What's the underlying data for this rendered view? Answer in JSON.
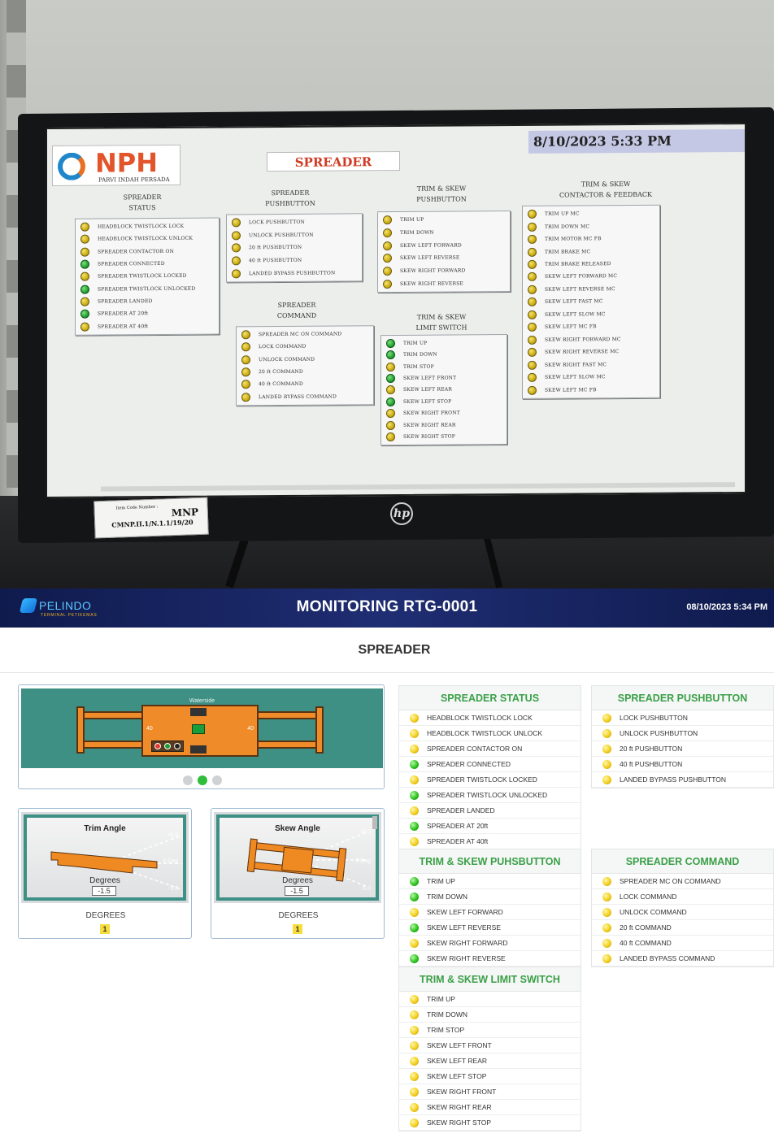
{
  "photo": {
    "hmi": {
      "logo_text": "NPH",
      "logo_sub": "PARVI INDAH PERSADA",
      "screen_title": "SPREADER",
      "datetime": "8/10/2023 5:33 PM",
      "titles": {
        "status": "SPREADER\nSTATUS",
        "pushbutton": "SPREADER\nPUSHBUTTON",
        "command": "SPREADER\nCOMMAND",
        "trim_push": "TRIM & SKEW\nPUSHBUTTON",
        "trim_limit": "TRIM & SKEW\nLIMIT SWITCH",
        "contactor": "TRIM & SKEW\nCONTACTOR & FEEDBACK"
      },
      "status_items": [
        {
          "label": "HEADBLOCK TWISTLOCK LOCK",
          "state": "yellow"
        },
        {
          "label": "HEADBLOCK TWISTLOCK UNLOCK",
          "state": "yellow"
        },
        {
          "label": "SPREADER CONTACTOR ON",
          "state": "yellow"
        },
        {
          "label": "SPREADER CONNECTED",
          "state": "green"
        },
        {
          "label": "SPREADER TWISTLOCK LOCKED",
          "state": "yellow"
        },
        {
          "label": "SPREADER TWISTLOCK UNLOCKED",
          "state": "green"
        },
        {
          "label": "SPREADER LANDED",
          "state": "yellow"
        },
        {
          "label": "SPREADER AT 20ft",
          "state": "green"
        },
        {
          "label": "SPREADER AT 40ft",
          "state": "yellow"
        }
      ],
      "pushbutton_items": [
        {
          "label": "LOCK PUSHBUTTON",
          "state": "yellow"
        },
        {
          "label": "UNLOCK PUSHBUTTON",
          "state": "yellow"
        },
        {
          "label": "20 ft PUSHBUTTON",
          "state": "yellow"
        },
        {
          "label": "40 ft PUSHBUTTON",
          "state": "yellow"
        },
        {
          "label": "LANDED BYPASS PUSHBUTTON",
          "state": "yellow"
        }
      ],
      "command_items": [
        {
          "label": "SPREADER MC ON COMMAND",
          "state": "yellow"
        },
        {
          "label": "LOCK COMMAND",
          "state": "yellow"
        },
        {
          "label": "UNLOCK COMMAND",
          "state": "yellow"
        },
        {
          "label": "20 ft COMMAND",
          "state": "yellow"
        },
        {
          "label": "40 ft COMMAND",
          "state": "yellow"
        },
        {
          "label": "LANDED BYPASS COMMAND",
          "state": "yellow"
        }
      ],
      "trim_push_items": [
        {
          "label": "TRIM UP",
          "state": "yellow"
        },
        {
          "label": "TRIM DOWN",
          "state": "yellow"
        },
        {
          "label": "SKEW LEFT FORWARD",
          "state": "yellow"
        },
        {
          "label": "SKEW LEFT REVERSE",
          "state": "yellow"
        },
        {
          "label": "SKEW RIGHT FORWARD",
          "state": "yellow"
        },
        {
          "label": "SKEW RIGHT REVERSE",
          "state": "yellow"
        }
      ],
      "trim_limit_items": [
        {
          "label": "TRIM UP",
          "state": "green"
        },
        {
          "label": "TRIM DOWN",
          "state": "green"
        },
        {
          "label": "TRIM STOP",
          "state": "yellow"
        },
        {
          "label": "SKEW LEFT FRONT",
          "state": "green"
        },
        {
          "label": "SKEW LEFT REAR",
          "state": "yellow"
        },
        {
          "label": "SKEW LEFT STOP",
          "state": "green"
        },
        {
          "label": "SKEW RIGHT FRONT",
          "state": "yellow"
        },
        {
          "label": "SKEW RIGHT REAR",
          "state": "yellow"
        },
        {
          "label": "SKEW RIGHT STOP",
          "state": "yellow"
        }
      ],
      "contactor_items": [
        {
          "label": "TRIM UP MC",
          "state": "yellow"
        },
        {
          "label": "TRIM DOWN MC",
          "state": "yellow"
        },
        {
          "label": "TRIM MOTOR MC FB",
          "state": "yellow"
        },
        {
          "label": "TRIM BRAKE MC",
          "state": "yellow"
        },
        {
          "label": "TRIM BRAKE RELEASED",
          "state": "yellow"
        },
        {
          "label": "SKEW LEFT FORWARD MC",
          "state": "yellow"
        },
        {
          "label": "SKEW LEFT REVERSE MC",
          "state": "yellow"
        },
        {
          "label": "SKEW LEFT FAST MC",
          "state": "yellow"
        },
        {
          "label": "SKEW LEFT SLOW MC",
          "state": "yellow"
        },
        {
          "label": "SKEW LEFT MC FB",
          "state": "yellow"
        },
        {
          "label": "SKEW RIGHT FORWARD MC",
          "state": "yellow"
        },
        {
          "label": "SKEW RIGHT REVERSE MC",
          "state": "yellow"
        },
        {
          "label": "SKEW RIGHT FAST MC",
          "state": "yellow"
        },
        {
          "label": "SKEW LEFT SLOW MC",
          "state": "yellow"
        },
        {
          "label": "SKEW LEFT MC FB",
          "state": "yellow"
        }
      ],
      "asset_label_title": "Item Code Number :",
      "asset_label_code": "CMNP.II.1/N.1.1/19/20",
      "asset_label_brand": "MNP",
      "monitor_brand": "hp"
    }
  },
  "header": {
    "brand_name": "PELINDO",
    "brand_sub": "TERMINAL PETIKEMAS",
    "title": "MONITORING RTG-0001",
    "datetime": "08/10/2023 5:34 PM"
  },
  "page": {
    "title": "SPREADER"
  },
  "carousel": {
    "waterside_label": "Waterside",
    "left_size": "40",
    "right_size": "40",
    "active_slide": 2,
    "slides": 3
  },
  "trim_angle": {
    "title": "Trim Angle",
    "degrees_label": "Degrees",
    "value": "-1.5",
    "tick_top": "+5.0",
    "tick_mid": "0 Deg",
    "tick_bottom": "-5.0",
    "caption": "DEGREES",
    "reading": "1"
  },
  "skew_angle": {
    "title": "Skew Angle",
    "degrees_label": "Degrees",
    "value": "-1.5",
    "tick_top": "+5.0",
    "tick_mid": "0 Deg",
    "tick_bottom": "-5.0",
    "caption": "DEGREES",
    "reading": "1"
  },
  "panels": {
    "spreader_status": {
      "title": "SPREADER STATUS",
      "items": [
        {
          "label": "HEADBLOCK TWISTLOCK LOCK",
          "state": "yellow"
        },
        {
          "label": "HEADBLOCK TWISTLOCK UNLOCK",
          "state": "yellow"
        },
        {
          "label": "SPREADER CONTACTOR ON",
          "state": "yellow"
        },
        {
          "label": "SPREADER CONNECTED",
          "state": "green"
        },
        {
          "label": "SPREADER TWISTLOCK LOCKED",
          "state": "yellow"
        },
        {
          "label": "SPREADER TWISTLOCK UNLOCKED",
          "state": "green"
        },
        {
          "label": "SPREADER LANDED",
          "state": "yellow"
        },
        {
          "label": "SPREADER AT 20ft",
          "state": "green"
        },
        {
          "label": "SPREADER AT 40ft",
          "state": "yellow"
        }
      ]
    },
    "spreader_pushbutton": {
      "title": "SPREADER PUSHBUTTON",
      "items": [
        {
          "label": "LOCK PUSHBUTTON",
          "state": "yellow"
        },
        {
          "label": "UNLOCK PUSHBUTTON",
          "state": "yellow"
        },
        {
          "label": "20 ft PUSHBUTTON",
          "state": "yellow"
        },
        {
          "label": "40 ft PUSHBUTTON",
          "state": "yellow"
        },
        {
          "label": "LANDED BYPASS PUSHBUTTON",
          "state": "yellow"
        }
      ]
    },
    "trim_skew_pushbutton": {
      "title": "TRIM & SKEW PUHSBUTTON",
      "items": [
        {
          "label": "TRIM UP",
          "state": "green"
        },
        {
          "label": "TRIM DOWN",
          "state": "green"
        },
        {
          "label": "SKEW LEFT FORWARD",
          "state": "yellow"
        },
        {
          "label": "SKEW LEFT REVERSE",
          "state": "green"
        },
        {
          "label": "SKEW RIGHT FORWARD",
          "state": "yellow"
        },
        {
          "label": "SKEW RIGHT REVERSE",
          "state": "green"
        }
      ]
    },
    "spreader_command": {
      "title": "SPREADER COMMAND",
      "items": [
        {
          "label": "SPREADER MC ON COMMAND",
          "state": "yellow"
        },
        {
          "label": "LOCK COMMAND",
          "state": "yellow"
        },
        {
          "label": "UNLOCK COMMAND",
          "state": "yellow"
        },
        {
          "label": "20 ft COMMAND",
          "state": "yellow"
        },
        {
          "label": "40 ft COMMAND",
          "state": "yellow"
        },
        {
          "label": "LANDED BYPASS COMMAND",
          "state": "yellow"
        }
      ]
    },
    "trim_skew_limit": {
      "title": "TRIM & SKEW LIMIT SWITCH",
      "items": [
        {
          "label": "TRIM UP",
          "state": "yellow"
        },
        {
          "label": "TRIM DOWN",
          "state": "yellow"
        },
        {
          "label": "TRIM STOP",
          "state": "yellow"
        },
        {
          "label": "SKEW LEFT FRONT",
          "state": "yellow"
        },
        {
          "label": "SKEW LEFT REAR",
          "state": "yellow"
        },
        {
          "label": "SKEW LEFT STOP",
          "state": "yellow"
        },
        {
          "label": "SKEW RIGHT FRONT",
          "state": "yellow"
        },
        {
          "label": "SKEW RIGHT REAR",
          "state": "yellow"
        },
        {
          "label": "SKEW RIGHT STOP",
          "state": "yellow"
        }
      ]
    }
  },
  "colors": {
    "header_bg": "#1f2d73",
    "panel_title": "#3aa047",
    "led_yellow": "#f2cf1f",
    "led_green": "#2ec41e",
    "hmi_title_red": "#d03a24"
  }
}
